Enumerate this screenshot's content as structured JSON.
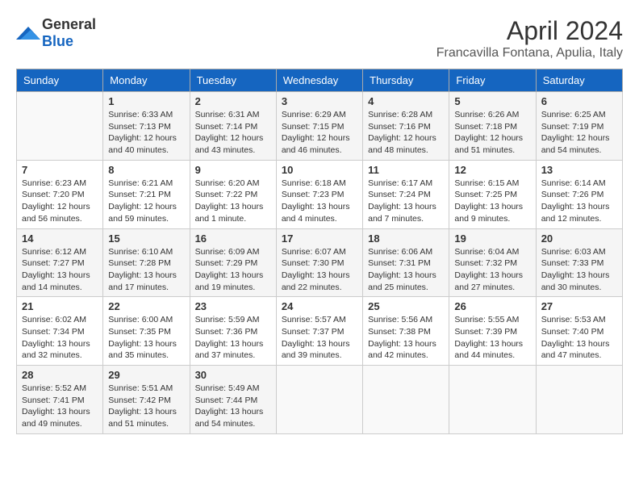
{
  "header": {
    "logo_general": "General",
    "logo_blue": "Blue",
    "month": "April 2024",
    "location": "Francavilla Fontana, Apulia, Italy"
  },
  "weekdays": [
    "Sunday",
    "Monday",
    "Tuesday",
    "Wednesday",
    "Thursday",
    "Friday",
    "Saturday"
  ],
  "weeks": [
    [
      {
        "day": "",
        "info": ""
      },
      {
        "day": "1",
        "info": "Sunrise: 6:33 AM\nSunset: 7:13 PM\nDaylight: 12 hours\nand 40 minutes."
      },
      {
        "day": "2",
        "info": "Sunrise: 6:31 AM\nSunset: 7:14 PM\nDaylight: 12 hours\nand 43 minutes."
      },
      {
        "day": "3",
        "info": "Sunrise: 6:29 AM\nSunset: 7:15 PM\nDaylight: 12 hours\nand 46 minutes."
      },
      {
        "day": "4",
        "info": "Sunrise: 6:28 AM\nSunset: 7:16 PM\nDaylight: 12 hours\nand 48 minutes."
      },
      {
        "day": "5",
        "info": "Sunrise: 6:26 AM\nSunset: 7:18 PM\nDaylight: 12 hours\nand 51 minutes."
      },
      {
        "day": "6",
        "info": "Sunrise: 6:25 AM\nSunset: 7:19 PM\nDaylight: 12 hours\nand 54 minutes."
      }
    ],
    [
      {
        "day": "7",
        "info": "Sunrise: 6:23 AM\nSunset: 7:20 PM\nDaylight: 12 hours\nand 56 minutes."
      },
      {
        "day": "8",
        "info": "Sunrise: 6:21 AM\nSunset: 7:21 PM\nDaylight: 12 hours\nand 59 minutes."
      },
      {
        "day": "9",
        "info": "Sunrise: 6:20 AM\nSunset: 7:22 PM\nDaylight: 13 hours\nand 1 minute."
      },
      {
        "day": "10",
        "info": "Sunrise: 6:18 AM\nSunset: 7:23 PM\nDaylight: 13 hours\nand 4 minutes."
      },
      {
        "day": "11",
        "info": "Sunrise: 6:17 AM\nSunset: 7:24 PM\nDaylight: 13 hours\nand 7 minutes."
      },
      {
        "day": "12",
        "info": "Sunrise: 6:15 AM\nSunset: 7:25 PM\nDaylight: 13 hours\nand 9 minutes."
      },
      {
        "day": "13",
        "info": "Sunrise: 6:14 AM\nSunset: 7:26 PM\nDaylight: 13 hours\nand 12 minutes."
      }
    ],
    [
      {
        "day": "14",
        "info": "Sunrise: 6:12 AM\nSunset: 7:27 PM\nDaylight: 13 hours\nand 14 minutes."
      },
      {
        "day": "15",
        "info": "Sunrise: 6:10 AM\nSunset: 7:28 PM\nDaylight: 13 hours\nand 17 minutes."
      },
      {
        "day": "16",
        "info": "Sunrise: 6:09 AM\nSunset: 7:29 PM\nDaylight: 13 hours\nand 19 minutes."
      },
      {
        "day": "17",
        "info": "Sunrise: 6:07 AM\nSunset: 7:30 PM\nDaylight: 13 hours\nand 22 minutes."
      },
      {
        "day": "18",
        "info": "Sunrise: 6:06 AM\nSunset: 7:31 PM\nDaylight: 13 hours\nand 25 minutes."
      },
      {
        "day": "19",
        "info": "Sunrise: 6:04 AM\nSunset: 7:32 PM\nDaylight: 13 hours\nand 27 minutes."
      },
      {
        "day": "20",
        "info": "Sunrise: 6:03 AM\nSunset: 7:33 PM\nDaylight: 13 hours\nand 30 minutes."
      }
    ],
    [
      {
        "day": "21",
        "info": "Sunrise: 6:02 AM\nSunset: 7:34 PM\nDaylight: 13 hours\nand 32 minutes."
      },
      {
        "day": "22",
        "info": "Sunrise: 6:00 AM\nSunset: 7:35 PM\nDaylight: 13 hours\nand 35 minutes."
      },
      {
        "day": "23",
        "info": "Sunrise: 5:59 AM\nSunset: 7:36 PM\nDaylight: 13 hours\nand 37 minutes."
      },
      {
        "day": "24",
        "info": "Sunrise: 5:57 AM\nSunset: 7:37 PM\nDaylight: 13 hours\nand 39 minutes."
      },
      {
        "day": "25",
        "info": "Sunrise: 5:56 AM\nSunset: 7:38 PM\nDaylight: 13 hours\nand 42 minutes."
      },
      {
        "day": "26",
        "info": "Sunrise: 5:55 AM\nSunset: 7:39 PM\nDaylight: 13 hours\nand 44 minutes."
      },
      {
        "day": "27",
        "info": "Sunrise: 5:53 AM\nSunset: 7:40 PM\nDaylight: 13 hours\nand 47 minutes."
      }
    ],
    [
      {
        "day": "28",
        "info": "Sunrise: 5:52 AM\nSunset: 7:41 PM\nDaylight: 13 hours\nand 49 minutes."
      },
      {
        "day": "29",
        "info": "Sunrise: 5:51 AM\nSunset: 7:42 PM\nDaylight: 13 hours\nand 51 minutes."
      },
      {
        "day": "30",
        "info": "Sunrise: 5:49 AM\nSunset: 7:44 PM\nDaylight: 13 hours\nand 54 minutes."
      },
      {
        "day": "",
        "info": ""
      },
      {
        "day": "",
        "info": ""
      },
      {
        "day": "",
        "info": ""
      },
      {
        "day": "",
        "info": ""
      }
    ]
  ]
}
